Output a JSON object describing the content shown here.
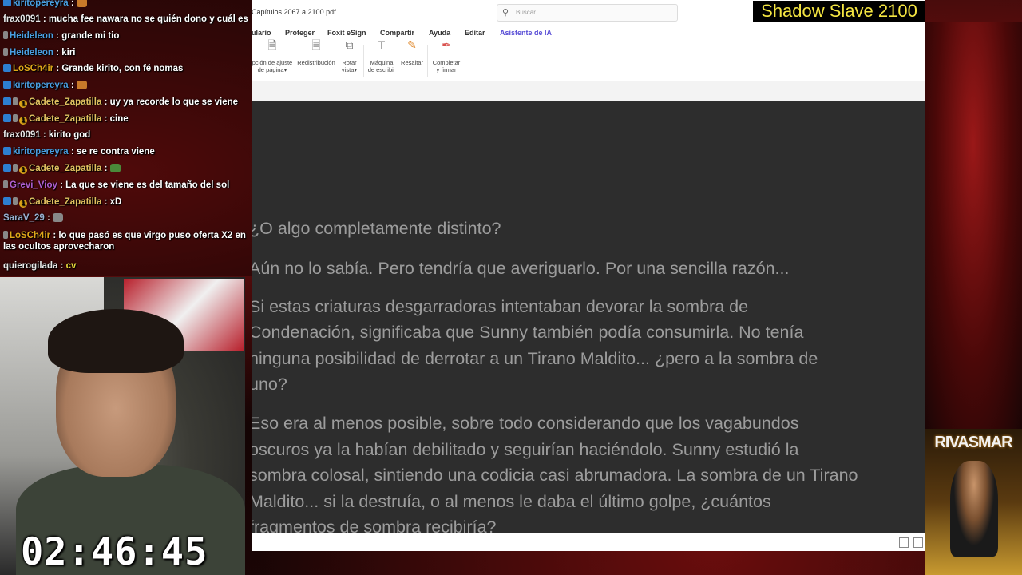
{
  "chat": {
    "messages": [
      {
        "user": "kiritopereyra",
        "color": "#4a9ee0",
        "text": "",
        "emote": true
      },
      {
        "user": "frax0091",
        "color": "#e8e8e8",
        "text": "mucha fee nawara no se quién dono y cuál es la"
      },
      {
        "user": "Heideleon",
        "color": "#4a9ee0",
        "text": "grande mi tio"
      },
      {
        "user": "Heideleon",
        "color": "#4a9ee0",
        "text": "kiri"
      },
      {
        "user": "LoSCh4ir",
        "color": "#e0a81a",
        "text": "Grande kirito, con fé nomas"
      },
      {
        "user": "kiritopereyra",
        "color": "#4a9ee0",
        "text": "",
        "emote": true
      },
      {
        "user": "Cadete_Zapatilla",
        "color": "#e0c060",
        "text": "uy ya recorde lo que se viene"
      },
      {
        "user": "Cadete_Zapatilla",
        "color": "#e0c060",
        "text": "cine"
      },
      {
        "user": "frax0091",
        "color": "#e8e8e8",
        "text": "kirito god"
      },
      {
        "user": "kiritopereyra",
        "color": "#4a9ee0",
        "text": "se re contra viene"
      },
      {
        "user": "Cadete_Zapatilla",
        "color": "#e0c060",
        "text": "",
        "emote": true
      },
      {
        "user": "Grevi_Vioy",
        "color": "#b05fd0",
        "text": "La que se viene es del tamaño del sol"
      },
      {
        "user": "Cadete_Zapatilla",
        "color": "#e0c060",
        "text": "xD"
      },
      {
        "user": "SaraV_29",
        "color": "#9ab0d0",
        "text": "",
        "emote": true
      },
      {
        "user": "LoSCh4ir",
        "color": "#e0a81a",
        "text": "lo que pasó es que virgo puso oferta X2 en las ocultos aprovecharon"
      },
      {
        "user": "quierogilada",
        "color": "#e8e8e8",
        "text": "cv"
      }
    ]
  },
  "timer": "02:46:45",
  "overlay_title": "Shadow Slave 2100",
  "poster_title": "RIVASMAR",
  "app": {
    "filename": "Capítulos 2067 a 2100.pdf",
    "search_placeholder": "Buscar",
    "menu": [
      "ulario",
      "Proteger",
      "Foxit eSign",
      "Compartir",
      "Ayuda",
      "Editar",
      "Asistente de IA"
    ],
    "ribbon": [
      {
        "label1": "pción de ajuste",
        "label2": "de página▾",
        "icon": "page-fit-icon"
      },
      {
        "label1": "Redistribución",
        "label2": "",
        "icon": "reflow-icon"
      },
      {
        "label1": "Rotar",
        "label2": "vista▾",
        "icon": "rotate-icon"
      },
      {
        "label1": "Máquina",
        "label2": "de escribir",
        "icon": "typewriter-icon"
      },
      {
        "label1": "Resaltar",
        "label2": "",
        "icon": "highlight-icon"
      },
      {
        "label1": "Completar",
        "label2": "y firmar",
        "icon": "fill-sign-icon"
      }
    ],
    "document": {
      "lines": [
        "¿O algo completamente distinto?",
        "Aún no lo sabía. Pero tendría que averiguarlo. Por una sencilla razón...",
        "Si estas criaturas desgarradoras intentaban devorar la sombra de",
        "Condenación, significaba que Sunny también podía consumirla. No tenía",
        "ninguna posibilidad de derrotar a un Tirano Maldito... ¿pero a la sombra de",
        "uno?",
        "Eso era al menos posible, sobre todo considerando que los vagabundos",
        "oscuros ya la habían debilitado y seguirían haciéndolo. Sunny estudió la",
        "sombra colosal, sintiendo una codicia casi abrumadora. La sombra de un Tirano",
        "Maldito... si la destruía, o al menos le daba el último golpe, ¿cuántos",
        "fragmentos de sombra recibiría?"
      ]
    }
  }
}
